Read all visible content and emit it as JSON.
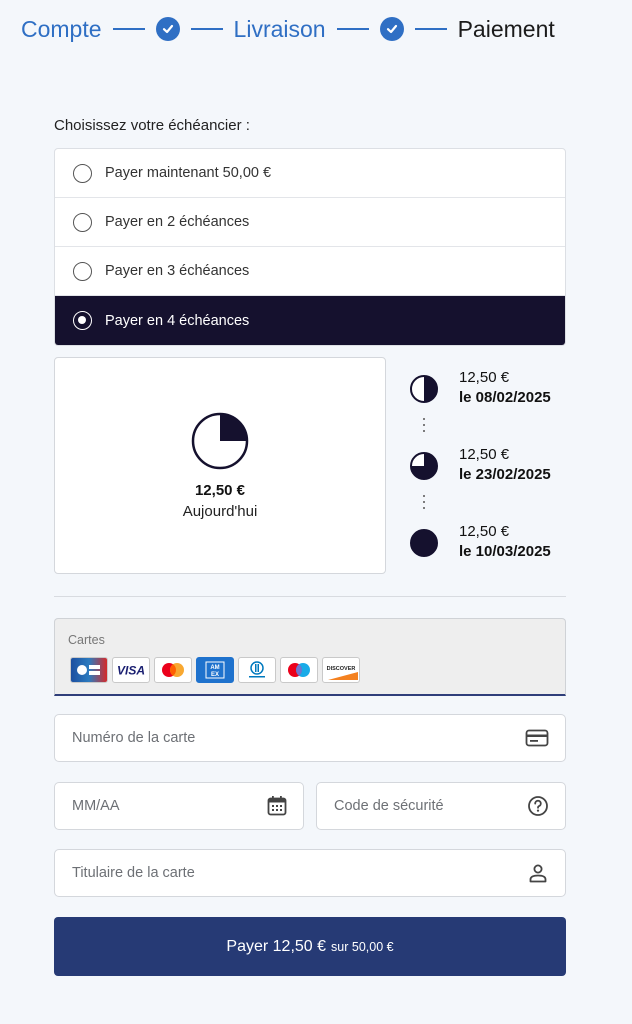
{
  "stepper": {
    "steps": [
      {
        "label": "Compte",
        "status": "done"
      },
      {
        "label": "Livraison",
        "status": "done"
      },
      {
        "label": "Paiement",
        "status": "current"
      }
    ]
  },
  "schedule": {
    "title": "Choisissez votre échéancier :",
    "options": [
      {
        "label": "Payer maintenant 50,00 €",
        "selected": false
      },
      {
        "label": "Payer en 2 échéances",
        "selected": false
      },
      {
        "label": "Payer en 3 échéances",
        "selected": false
      },
      {
        "label": "Payer en 4 échéances",
        "selected": true
      }
    ]
  },
  "today": {
    "amount": "12,50 €",
    "label": "Aujourd'hui",
    "fraction": 0.25
  },
  "installments": [
    {
      "amount": "12,50 €",
      "date": "le 08/02/2025",
      "fraction": 0.5
    },
    {
      "amount": "12,50 €",
      "date": "le 23/02/2025",
      "fraction": 0.75
    },
    {
      "amount": "12,50 €",
      "date": "le 10/03/2025",
      "fraction": 1.0
    }
  ],
  "payment": {
    "cards_label": "Cartes",
    "card_brands": [
      "cb",
      "visa",
      "mastercard",
      "amex",
      "diners-club",
      "maestro",
      "discover"
    ],
    "card_number_placeholder": "Numéro de la carte",
    "expiry_placeholder": "MM/AA",
    "cvc_placeholder": "Code de sécurité",
    "holder_placeholder": "Titulaire de la carte",
    "pay_button_main": "Payer 12,50 €",
    "pay_button_sub": "sur 50,00 €"
  },
  "colors": {
    "accent": "#2f6fc4",
    "selected_option_bg": "#15112e",
    "pay_button_bg": "#263a75",
    "page_bg": "#f4f7fb"
  }
}
